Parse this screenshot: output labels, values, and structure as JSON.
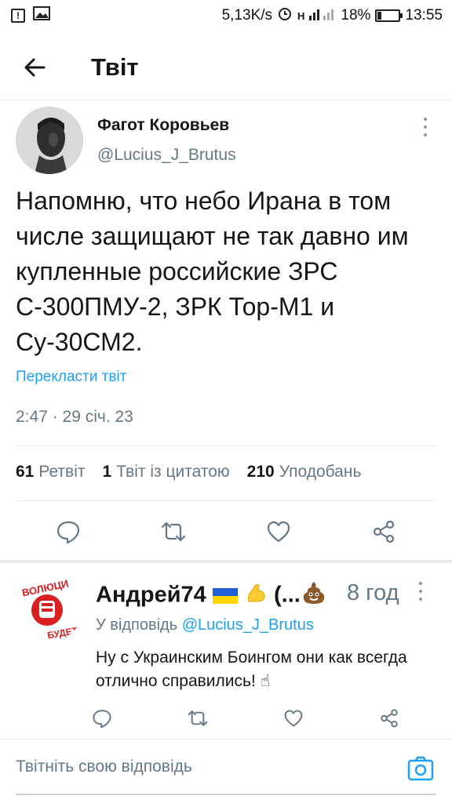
{
  "status_bar": {
    "speed": "5,13K/s",
    "battery": "18%",
    "battery_level": 0.18,
    "time": "13:55",
    "network": "H"
  },
  "header": {
    "title": "Твіт"
  },
  "tweet": {
    "author_name": "Фагот Коровьев",
    "author_handle": "@Lucius_J_Brutus",
    "text": "Напомню, что небо Ирана в том числе защищают не так давно им купленные российские ЗРС С-300ПМУ-2, ЗРК Тор-М1 и Су-30СМ2.",
    "translate_label": "Перекласти твіт",
    "timestamp": "2:47 · 29 січ. 23",
    "stats": {
      "retweets_count": "61",
      "retweets_label": "Ретвіт",
      "quotes_count": "1",
      "quotes_label": "Твіт із цитатою",
      "likes_count": "210",
      "likes_label": "Уподобань"
    }
  },
  "reply": {
    "author_name": "Андрей74",
    "name_suffix": "(...",
    "time": "8 год",
    "reply_to_label": "У відповідь",
    "reply_to_handle": "@Lucius_J_Brutus",
    "text": "Ну с Украинским Боингом они как всегда отлично справились! ☝",
    "avatar_text_top": "ВОЛЮЦИ",
    "avatar_text_bottom": "БУДЕТ"
  },
  "compose": {
    "placeholder": "Твітніть свою відповідь"
  },
  "colors": {
    "accent": "#1da1f2",
    "secondary_text": "#657786",
    "divider": "#e6ecf0",
    "icon": "#657786"
  }
}
